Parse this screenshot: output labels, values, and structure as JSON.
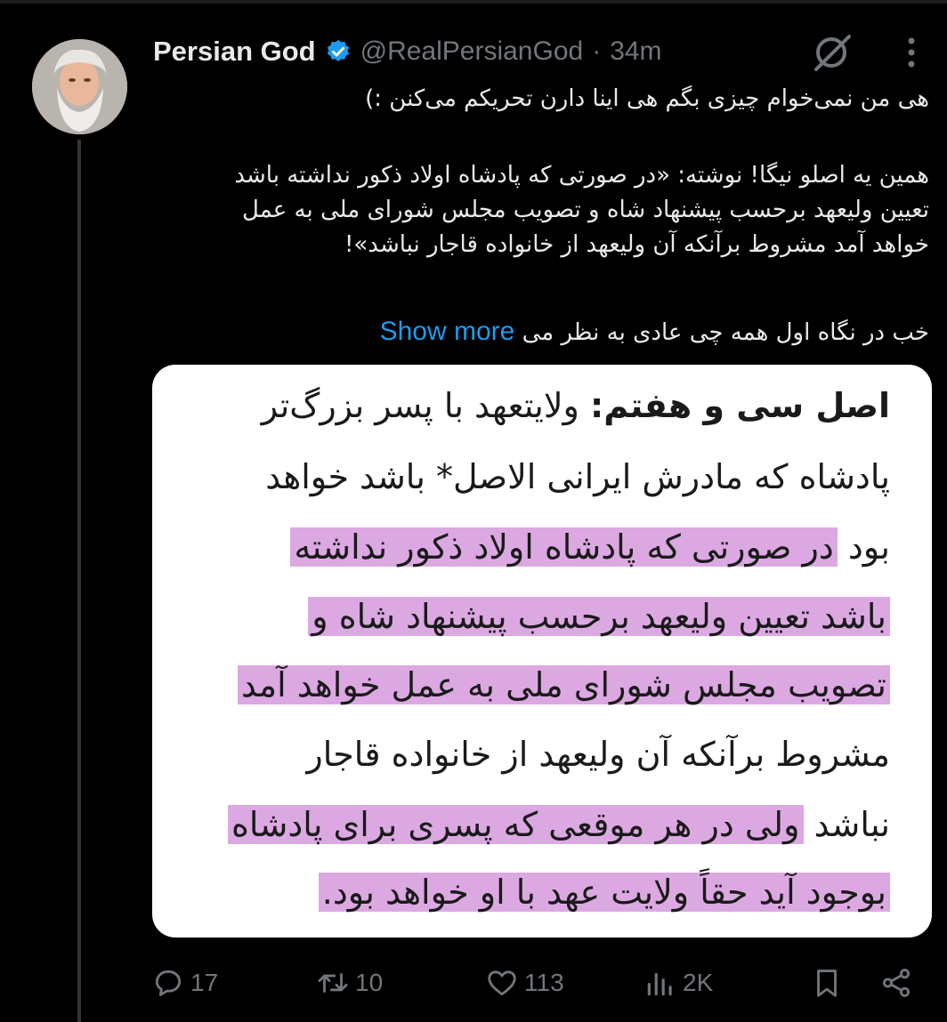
{
  "author": {
    "display_name": "Persian God",
    "handle": "@RealPersianGod",
    "separator": "·",
    "time": "34m"
  },
  "tweet": {
    "line1": "هی من نمی‌خوام چیزی بگم هی اینا دارن تحریکم می‌کنن :)",
    "para2": [
      "همین یه اصلو نیگا! نوشته: «در صورتی که پادشاه اولاد ذکور نداشته باشد",
      "تعیین ولیعهد برحسب پیشنهاد شاه و تصویب مجلس شورای ملی به عمل",
      "خواهد آمد مشروط برآنکه آن ولیعهد از خانواده قاجار نباشد»!"
    ],
    "last_line": "خب در نگاه اول همه چی عادی به نظر می",
    "show_more": "Show more"
  },
  "media": {
    "line1_bold": "اصل سی و هفتم:",
    "line1_rest": " ولایتعهد با پسر بزرگ‌تر",
    "line2": "پادشاه که مادرش ایرانی الاصل* باشد خواهد",
    "line3_plain": "بود ",
    "line3_hl": "در صورتی که پادشاه اولاد ذکور نداشته",
    "line4_hl": "باشد تعیین ولیعهد برحسب پیشنهاد شاه و",
    "line5_hl": "تصویب مجلس شورای ملی به عمل خواهد آمد",
    "line6": "مشروط برآنکه آن ولیعهد از خانواده قاجار",
    "line7_plain": "نباشد ",
    "line7_hl": "ولی در هر موقعی که پسری برای پادشاه",
    "line8_hl": "بوجود آید حقاً ولایت عهد با او خواهد بود.",
    "highlight_color": "#dca8e2"
  },
  "actions": {
    "reply_count": "17",
    "repost_count": "10",
    "like_count": "113",
    "views_count": "2K"
  },
  "colors": {
    "background": "#000000",
    "text": "#e7e9ea",
    "muted": "#71767b",
    "accent": "#1d9bf0"
  }
}
